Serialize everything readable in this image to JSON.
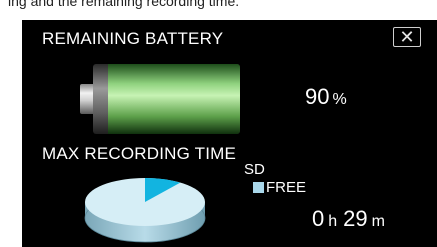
{
  "top_strip_text": "ing and the remaining recording time.",
  "battery": {
    "title": "REMAINING BATTERY",
    "percent": 90,
    "percent_value": "90",
    "percent_unit": "%"
  },
  "close_button": {
    "label": "✕",
    "icon": "close-icon"
  },
  "recording": {
    "title": "MAX RECORDING TIME",
    "media_label": "SD",
    "legend_label": "FREE",
    "hours": "0",
    "hours_unit": "h",
    "minutes": "29",
    "minutes_unit": "m",
    "free_fraction": 0.1
  },
  "colors": {
    "background": "#000000",
    "text": "#ffffff",
    "battery_fill": "#8fd27e",
    "free_slice": "#12b4e0",
    "pie_top": "#d6eef6",
    "legend_swatch": "#a9d7ea"
  }
}
